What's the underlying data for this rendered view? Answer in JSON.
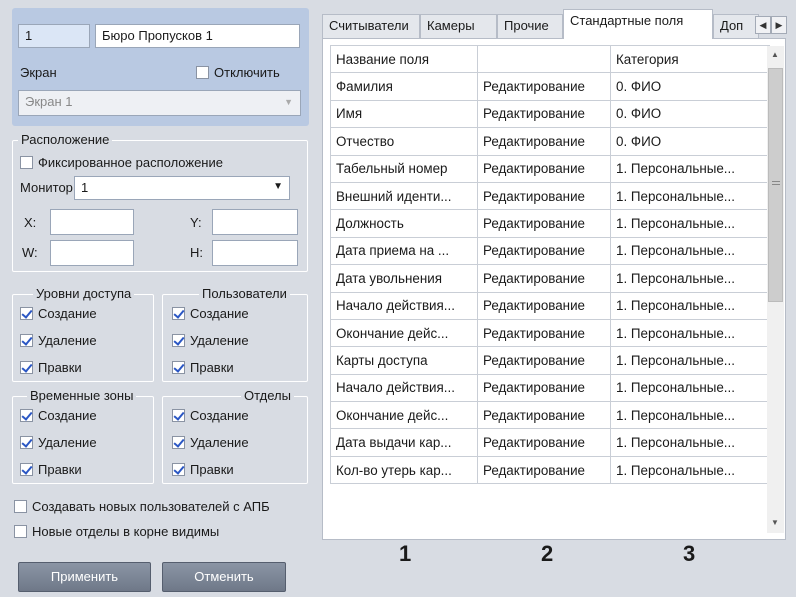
{
  "left": {
    "id_value": "1",
    "name_value": "Бюро Пропусков 1",
    "screen_label": "Экран",
    "disable_label": "Отключить",
    "screen_select_value": "Экран 1",
    "location_title": "Расположение",
    "fixed_location_label": "Фиксированное расположение",
    "monitor_label": "Монитор",
    "monitor_value": "1",
    "x_label": "X:",
    "y_label": "Y:",
    "w_label": "W:",
    "h_label": "H:",
    "access_levels": {
      "title": "Уровни доступа",
      "create": "Создание",
      "delete": "Удаление",
      "edit": "Правки"
    },
    "users": {
      "title": "Пользователи",
      "create": "Создание",
      "delete": "Удаление",
      "edit": "Правки"
    },
    "time_zones": {
      "title": "Временные зоны",
      "create": "Создание",
      "delete": "Удаление",
      "edit": "Правки"
    },
    "departments": {
      "title": "Отделы",
      "create": "Создание",
      "delete": "Удаление",
      "edit": "Правки"
    },
    "create_users_apb": "Создавать новых пользователей с АПБ",
    "new_departments_root": "Новые отделы в корне видимы"
  },
  "buttons": {
    "apply": "Применить",
    "cancel": "Отменить"
  },
  "tabs": [
    "Считыватели",
    "Камеры",
    "Прочие",
    "Стандартные поля",
    "Доп"
  ],
  "table": {
    "headers": [
      "Название поля",
      "",
      "Категория"
    ],
    "rows": [
      [
        "Фамилия",
        "Редактирование",
        "0. ФИО"
      ],
      [
        "Имя",
        "Редактирование",
        "0. ФИО"
      ],
      [
        "Отчество",
        "Редактирование",
        "0. ФИО"
      ],
      [
        "Табельный номер",
        "Редактирование",
        "1. Персональные..."
      ],
      [
        "Внешний иденти...",
        "Редактирование",
        "1. Персональные..."
      ],
      [
        "Должность",
        "Редактирование",
        "1. Персональные..."
      ],
      [
        "Дата приема на ...",
        "Редактирование",
        "1. Персональные..."
      ],
      [
        "Дата увольнения",
        "Редактирование",
        "1. Персональные..."
      ],
      [
        "Начало действия...",
        "Редактирование",
        "1. Персональные..."
      ],
      [
        "Окончание дейс...",
        "Редактирование",
        "1. Персональные..."
      ],
      [
        "Карты доступа",
        "Редактирование",
        "1. Персональные..."
      ],
      [
        "Начало действия...",
        "Редактирование",
        "1. Персональные..."
      ],
      [
        "Окончание дейс...",
        "Редактирование",
        "1. Персональные..."
      ],
      [
        "Дата выдачи кар...",
        "Редактирование",
        "1. Персональные..."
      ],
      [
        "Кол-во утерь кар...",
        "Редактирование",
        "1. Персональные..."
      ]
    ]
  },
  "annotations": [
    "1",
    "2",
    "3"
  ]
}
